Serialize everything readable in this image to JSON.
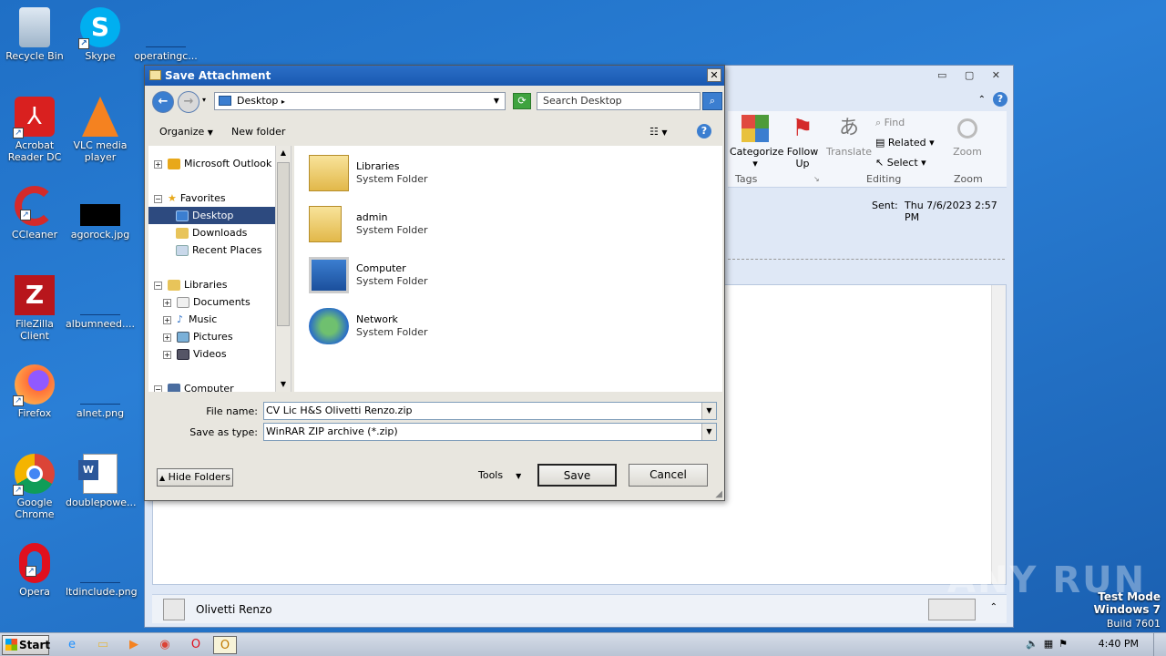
{
  "desktop": {
    "icons": [
      {
        "label": "Recycle Bin",
        "icon": "recycle-bin-icon"
      },
      {
        "label": "Skype",
        "icon": "skype-icon"
      },
      {
        "label": "operatingc...",
        "icon": "file-icon"
      },
      {
        "label": "Acrobat Reader DC",
        "icon": "acrobat-icon"
      },
      {
        "label": "VLC media player",
        "icon": "vlc-icon"
      },
      {
        "label": "CCleaner",
        "icon": "ccleaner-icon"
      },
      {
        "label": "agorock.jpg",
        "icon": "image-icon"
      },
      {
        "label": "FileZilla Client",
        "icon": "filezilla-icon"
      },
      {
        "label": "albumneed....",
        "icon": "file-icon"
      },
      {
        "label": "Firefox",
        "icon": "firefox-icon"
      },
      {
        "label": "alnet.png",
        "icon": "image-icon"
      },
      {
        "label": "Google Chrome",
        "icon": "chrome-icon"
      },
      {
        "label": "doublepowe...",
        "icon": "word-icon"
      },
      {
        "label": "Opera",
        "icon": "opera-icon"
      },
      {
        "label": "ltdinclude.png",
        "icon": "image-icon"
      }
    ]
  },
  "outlook": {
    "ribbon": {
      "categorize": "Categorize",
      "follow_up": "Follow Up",
      "tags_label": "Tags",
      "translate": "Translate",
      "find": "Find",
      "related": "Related",
      "select": "Select",
      "editing_label": "Editing",
      "zoom": "Zoom",
      "zoom_label": "Zoom"
    },
    "sent_label": "Sent:",
    "sent_value": "Thu 7/6/2023 2:57 PM",
    "sender_name": "Olivetti Renzo"
  },
  "dialog": {
    "title": "Save Attachment",
    "close": "✕",
    "address": "Desktop",
    "search_placeholder": "Search Desktop",
    "organize": "Organize",
    "new_folder": "New folder",
    "nav": {
      "microsoft_outlook": "Microsoft Outlook",
      "favorites": "Favorites",
      "desktop": "Desktop",
      "downloads": "Downloads",
      "recent_places": "Recent Places",
      "libraries": "Libraries",
      "documents": "Documents",
      "music": "Music",
      "pictures": "Pictures",
      "videos": "Videos",
      "computer": "Computer"
    },
    "files": [
      {
        "name": "Libraries",
        "type": "System Folder"
      },
      {
        "name": "admin",
        "type": "System Folder"
      },
      {
        "name": "Computer",
        "type": "System Folder"
      },
      {
        "name": "Network",
        "type": "System Folder"
      }
    ],
    "file_name_label": "File name:",
    "file_name_value": "CV Lic H&S Olivetti Renzo.zip",
    "save_type_label": "Save as type:",
    "save_type_value": "WinRAR ZIP archive (*.zip)",
    "hide_folders": "Hide Folders",
    "tools": "Tools",
    "save": "Save",
    "cancel": "Cancel"
  },
  "taskbar": {
    "start": "Start",
    "time": "4:40 PM"
  },
  "watermark": {
    "line1": "Test Mode",
    "line2": "Windows 7",
    "line3": "Build 7601",
    "brand": "ANY RUN"
  }
}
